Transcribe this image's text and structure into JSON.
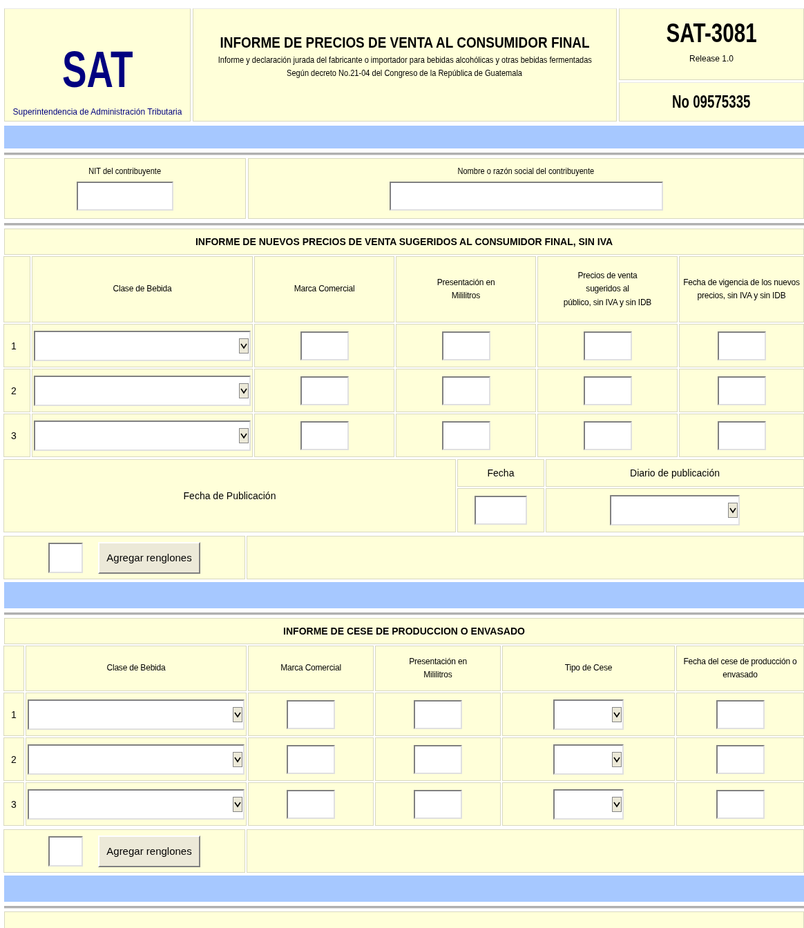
{
  "header": {
    "logo": "SAT",
    "agency": "Superintendencia de Administración Tributaria",
    "title": "INFORME DE PRECIOS DE VENTA AL CONSUMIDOR FINAL",
    "subtitle": "Informe y declaración jurada del fabricante o importador para bebidas alcohólicas y otras bebidas fermentadas",
    "decree": "Según decreto No.21-04 del Congreso de la República de Guatemala",
    "form_code": "SAT-3081",
    "release": "Release 1.0",
    "number": "No 09575335"
  },
  "taxpayer": {
    "fields": [
      {
        "label": "NIT del contribuyente",
        "kind": "short"
      },
      {
        "label": "Nombre o razón social del contribuyente",
        "kind": "long"
      }
    ]
  },
  "price_report": {
    "title": "INFORME DE NUEVOS PRECIOS DE VENTA SUGERIDOS AL CONSUMIDOR FINAL, SIN IVA",
    "columns": [
      {
        "label": "Clase de Bebida",
        "kind": "select"
      },
      {
        "label": "Marca Comercial",
        "kind": "input"
      },
      {
        "label": "Presentación en\nMililitros",
        "kind": "input"
      },
      {
        "label": "Precios de venta\nsugeridos al\npúblico, sin IVA y sin IDB",
        "kind": "input"
      },
      {
        "label": "Fecha de vigencia de los nuevos\nprecios, sin IVA y sin IDB",
        "kind": "input"
      }
    ],
    "rows": [
      {
        "number": "1"
      },
      {
        "number": "2"
      },
      {
        "number": "3"
      }
    ],
    "publication": {
      "label": "Fecha de Publicación",
      "date_label": "Fecha",
      "newspaper_label": "Diario de publicación"
    },
    "add_button": "Agregar renglones"
  },
  "cessation_report": {
    "title": "INFORME DE CESE DE PRODUCCION O ENVASADO",
    "columns": [
      {
        "label": "Clase de Bebida",
        "kind": "select"
      },
      {
        "label": "Marca Comercial",
        "kind": "input"
      },
      {
        "label": "Presentación en\nMililitros",
        "kind": "input"
      },
      {
        "label": "Tipo de Cese",
        "kind": "small_select"
      },
      {
        "label": "Fecha del cese de producción o\nenvasado",
        "kind": "input"
      }
    ],
    "rows": [
      {
        "number": "1"
      },
      {
        "number": "2"
      },
      {
        "number": "3"
      }
    ],
    "add_button": "Agregar renglones"
  }
}
